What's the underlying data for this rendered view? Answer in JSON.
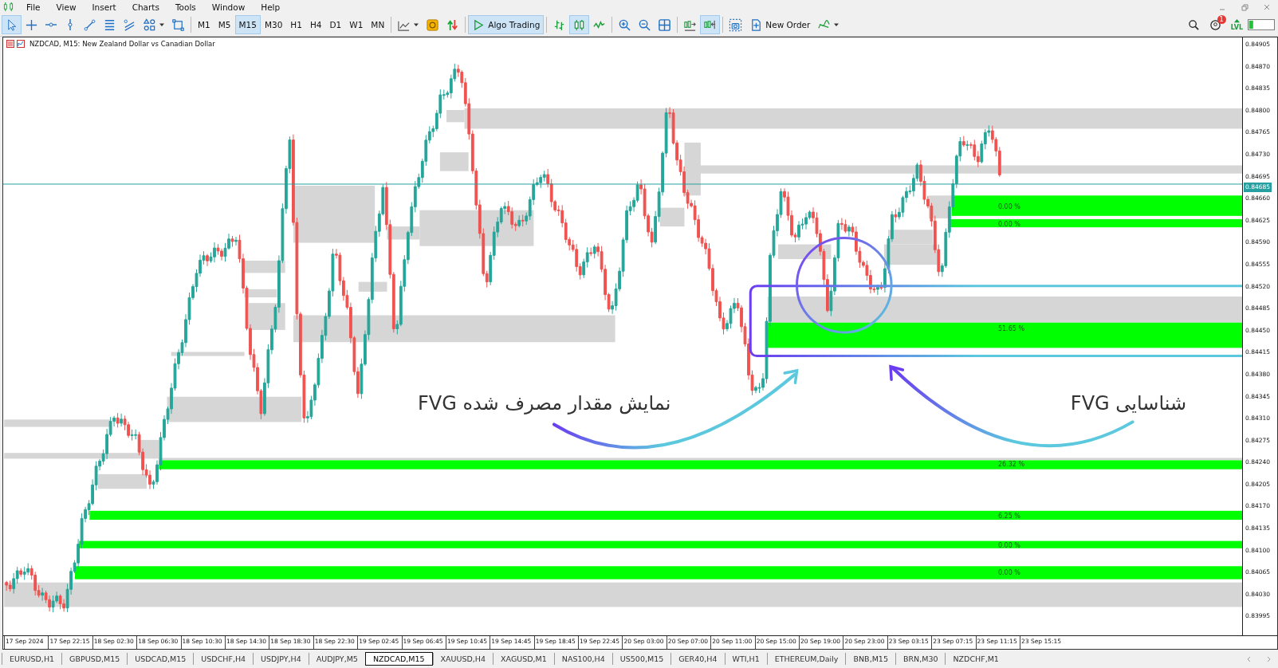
{
  "menu": [
    "File",
    "View",
    "Insert",
    "Charts",
    "Tools",
    "Window",
    "Help"
  ],
  "toolbar": [
    [
      {
        "kind": "cursor",
        "selected": true
      },
      {
        "kind": "crosshair",
        "selected": false
      },
      {
        "kind": "hline",
        "selected": false
      },
      {
        "kind": "vline",
        "selected": false
      },
      {
        "kind": "trendline",
        "selected": false
      },
      {
        "kind": "channels",
        "selected": false
      },
      {
        "kind": "curves",
        "selected": false
      },
      {
        "kind": "shapes",
        "selected": false
      },
      {
        "kind": "rectangle",
        "selected": false
      }
    ],
    [
      {
        "kind": "timeframe",
        "label": "M1",
        "selected": false
      },
      {
        "kind": "timeframe",
        "label": "M5",
        "selected": false
      },
      {
        "kind": "timeframe",
        "label": "M15",
        "selected": true
      },
      {
        "kind": "timeframe",
        "label": "M30",
        "selected": false
      },
      {
        "kind": "timeframe",
        "label": "H1",
        "selected": false
      },
      {
        "kind": "timeframe",
        "label": "H4",
        "selected": false
      },
      {
        "kind": "timeframe",
        "label": "D1",
        "selected": false
      },
      {
        "kind": "timeframe",
        "label": "W1",
        "selected": false
      },
      {
        "kind": "timeframe",
        "label": "MN",
        "selected": false
      }
    ],
    [
      {
        "kind": "chartline",
        "selected": false
      },
      {
        "kind": "market",
        "selected": false
      },
      {
        "kind": "trade",
        "selected": false
      }
    ],
    [
      {
        "kind": "algo",
        "label": "Algo Trading",
        "selected": true
      }
    ],
    [
      {
        "kind": "bars",
        "selected": false
      },
      {
        "kind": "candles",
        "selected": true
      },
      {
        "kind": "line",
        "selected": false
      }
    ],
    [
      {
        "kind": "zoomin",
        "selected": false
      },
      {
        "kind": "zoomout",
        "selected": false
      },
      {
        "kind": "tile",
        "selected": false
      }
    ],
    [
      {
        "kind": "shift",
        "selected": false
      },
      {
        "kind": "autoscroll",
        "selected": true
      }
    ],
    [
      {
        "kind": "screenshot",
        "selected": false
      },
      {
        "kind": "neworder",
        "label": "New Order",
        "selected": false
      },
      {
        "kind": "indicators",
        "selected": false
      }
    ]
  ],
  "status": {
    "notification_count": "1",
    "signal_label": "LVL"
  },
  "chart": {
    "title": "NZDCAD, M15:  New Zealand Dollar vs Canadian Dollar",
    "price_ticks": [
      "0.84905",
      "0.84870",
      "0.84835",
      "0.84800",
      "0.84765",
      "0.84730",
      "0.84695",
      "0.84660",
      "0.84625",
      "0.84590",
      "0.84555",
      "0.84520",
      "0.84485",
      "0.84450",
      "0.84415",
      "0.84380",
      "0.84345",
      "0.84310",
      "0.84275",
      "0.84240",
      "0.84205",
      "0.84170",
      "0.84135",
      "0.84100",
      "0.84065",
      "0.84030",
      "0.83995"
    ],
    "current_price": "0.84685",
    "time_labels": [
      "17 Sep 2024",
      "17 Sep 22:15",
      "18 Sep 02:30",
      "18 Sep 06:30",
      "18 Sep 10:30",
      "18 Sep 14:30",
      "18 Sep 18:30",
      "18 Sep 22:30",
      "19 Sep 02:45",
      "19 Sep 06:45",
      "19 Sep 10:45",
      "19 Sep 14:45",
      "19 Sep 18:45",
      "19 Sep 22:45",
      "20 Sep 03:00",
      "20 Sep 07:00",
      "20 Sep 11:00",
      "20 Sep 15:00",
      "20 Sep 19:00",
      "20 Sep 23:00",
      "23 Sep 03:15",
      "23 Sep 07:15",
      "23 Sep 11:15",
      "23 Sep 15:15"
    ],
    "fvg_labels": [
      "0.00 %",
      "0.00 %",
      "51.65 %",
      "26.32 %",
      "6.25 %",
      "0.00 %",
      "0.00 %"
    ],
    "annotations": [
      "شناسایی FVG",
      "نمایش مقدار مصرف شده FVG"
    ]
  },
  "tabs": [
    {
      "label": "EURUSD,H1",
      "selected": false
    },
    {
      "label": "GBPUSD,M15",
      "selected": false
    },
    {
      "label": "USDCAD,M15",
      "selected": false
    },
    {
      "label": "USDCHF,H4",
      "selected": false
    },
    {
      "label": "USDJPY,H4",
      "selected": false
    },
    {
      "label": "AUDJPY,M5",
      "selected": false
    },
    {
      "label": "NZDCAD,M15",
      "selected": true
    },
    {
      "label": "XAUUSD,H4",
      "selected": false
    },
    {
      "label": "XAGUSD,M1",
      "selected": false
    },
    {
      "label": "NAS100,H4",
      "selected": false
    },
    {
      "label": "US500,M15",
      "selected": false
    },
    {
      "label": "GER40,H4",
      "selected": false
    },
    {
      "label": "WTI,H1",
      "selected": false
    },
    {
      "label": "ETHEREUM,Daily",
      "selected": false
    },
    {
      "label": "BNB,M15",
      "selected": false
    },
    {
      "label": "BRN,M30",
      "selected": false
    },
    {
      "label": "NZDCHF,M1",
      "selected": false
    }
  ]
}
